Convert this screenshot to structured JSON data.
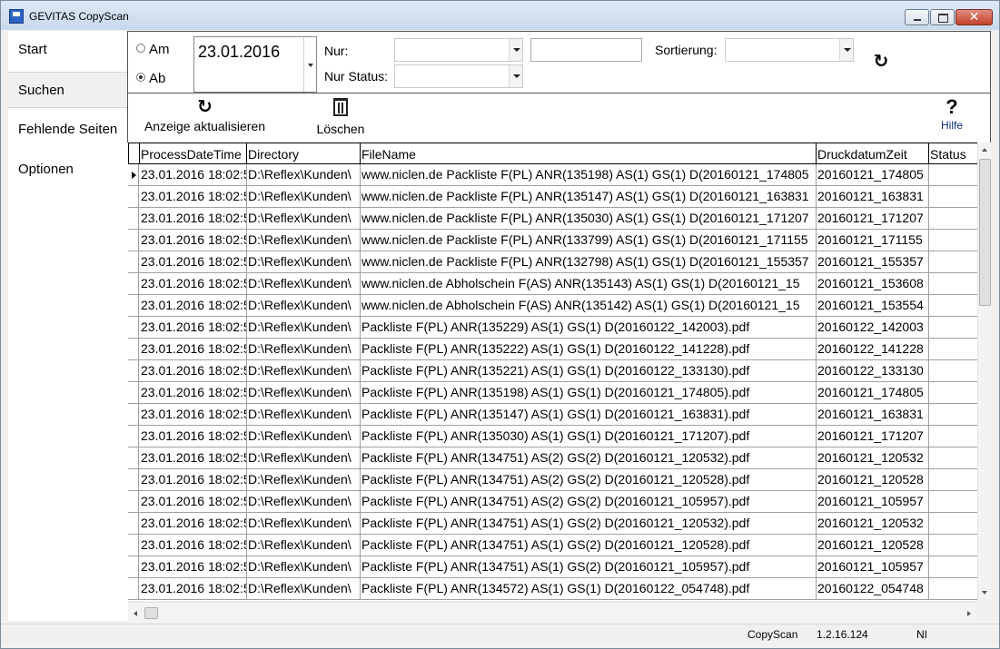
{
  "window": {
    "title": "GEVITAS CopyScan"
  },
  "nav": {
    "items": [
      {
        "label": "Start"
      },
      {
        "label": "Suchen"
      },
      {
        "label": "Fehlende Seiten"
      },
      {
        "label": "Optionen"
      }
    ],
    "active": "Suchen"
  },
  "filter": {
    "radio_am": "Am",
    "radio_ab": "Ab",
    "selected_radio": "Ab",
    "date_value": "23.01.2016",
    "nur_label": "Nur:",
    "nur_value": "",
    "nur_status_label": "Nur Status:",
    "nur_status_value": "",
    "text_value": "",
    "sortierung_label": "Sortierung:",
    "sortierung_value": ""
  },
  "toolbar": {
    "refresh_label": "Anzeige aktualisieren",
    "delete_label": "Löschen",
    "help_label": "Hilfe",
    "help_glyph": "?"
  },
  "table": {
    "columns": [
      "ProcessDateTime",
      "Directory",
      "FileName",
      "DruckdatumZeit",
      "Status"
    ],
    "rows": [
      [
        "23.01.2016 18:02:5",
        "D:\\Reflex\\Kunden\\",
        "www.niclen.de Packliste F(PL) ANR(135198) AS(1) GS(1) D(20160121_174805",
        "20160121_174805",
        ""
      ],
      [
        "23.01.2016 18:02:5",
        "D:\\Reflex\\Kunden\\",
        "www.niclen.de Packliste F(PL) ANR(135147) AS(1) GS(1) D(20160121_163831",
        "20160121_163831",
        ""
      ],
      [
        "23.01.2016 18:02:5",
        "D:\\Reflex\\Kunden\\",
        "www.niclen.de Packliste F(PL) ANR(135030) AS(1) GS(1) D(20160121_171207",
        "20160121_171207",
        ""
      ],
      [
        "23.01.2016 18:02:5",
        "D:\\Reflex\\Kunden\\",
        "www.niclen.de Packliste F(PL) ANR(133799) AS(1) GS(1) D(20160121_171155",
        "20160121_171155",
        ""
      ],
      [
        "23.01.2016 18:02:5",
        "D:\\Reflex\\Kunden\\",
        "www.niclen.de Packliste F(PL) ANR(132798) AS(1) GS(1) D(20160121_155357",
        "20160121_155357",
        ""
      ],
      [
        "23.01.2016 18:02:5",
        "D:\\Reflex\\Kunden\\",
        "www.niclen.de Abholschein F(AS) ANR(135143) AS(1) GS(1) D(20160121_15",
        "20160121_153608",
        ""
      ],
      [
        "23.01.2016 18:02:5",
        "D:\\Reflex\\Kunden\\",
        "www.niclen.de Abholschein F(AS) ANR(135142) AS(1) GS(1) D(20160121_15",
        "20160121_153554",
        ""
      ],
      [
        "23.01.2016 18:02:5",
        "D:\\Reflex\\Kunden\\",
        "Packliste F(PL) ANR(135229) AS(1) GS(1) D(20160122_142003).pdf",
        "20160122_142003",
        ""
      ],
      [
        "23.01.2016 18:02:5",
        "D:\\Reflex\\Kunden\\",
        "Packliste F(PL) ANR(135222) AS(1) GS(1) D(20160122_141228).pdf",
        "20160122_141228",
        ""
      ],
      [
        "23.01.2016 18:02:5",
        "D:\\Reflex\\Kunden\\",
        "Packliste F(PL) ANR(135221) AS(1) GS(1) D(20160122_133130).pdf",
        "20160122_133130",
        ""
      ],
      [
        "23.01.2016 18:02:5",
        "D:\\Reflex\\Kunden\\",
        "Packliste F(PL) ANR(135198) AS(1) GS(1) D(20160121_174805).pdf",
        "20160121_174805",
        ""
      ],
      [
        "23.01.2016 18:02:5",
        "D:\\Reflex\\Kunden\\",
        "Packliste F(PL) ANR(135147) AS(1) GS(1) D(20160121_163831).pdf",
        "20160121_163831",
        ""
      ],
      [
        "23.01.2016 18:02:5",
        "D:\\Reflex\\Kunden\\",
        "Packliste F(PL) ANR(135030) AS(1) GS(1) D(20160121_171207).pdf",
        "20160121_171207",
        ""
      ],
      [
        "23.01.2016 18:02:5",
        "D:\\Reflex\\Kunden\\",
        "Packliste F(PL) ANR(134751) AS(2) GS(2) D(20160121_120532).pdf",
        "20160121_120532",
        ""
      ],
      [
        "23.01.2016 18:02:5",
        "D:\\Reflex\\Kunden\\",
        "Packliste F(PL) ANR(134751) AS(2) GS(2) D(20160121_120528).pdf",
        "20160121_120528",
        ""
      ],
      [
        "23.01.2016 18:02:5",
        "D:\\Reflex\\Kunden\\",
        "Packliste F(PL) ANR(134751) AS(2) GS(2) D(20160121_105957).pdf",
        "20160121_105957",
        ""
      ],
      [
        "23.01.2016 18:02:5",
        "D:\\Reflex\\Kunden\\",
        "Packliste F(PL) ANR(134751) AS(1) GS(2) D(20160121_120532).pdf",
        "20160121_120532",
        ""
      ],
      [
        "23.01.2016 18:02:5",
        "D:\\Reflex\\Kunden\\",
        "Packliste F(PL) ANR(134751) AS(1) GS(2) D(20160121_120528).pdf",
        "20160121_120528",
        ""
      ],
      [
        "23.01.2016 18:02:5",
        "D:\\Reflex\\Kunden\\",
        "Packliste F(PL) ANR(134751) AS(1) GS(2) D(20160121_105957).pdf",
        "20160121_105957",
        ""
      ],
      [
        "23.01.2016 18:02:5",
        "D:\\Reflex\\Kunden\\",
        "Packliste F(PL) ANR(134572) AS(1) GS(1) D(20160122_054748).pdf",
        "20160122_054748",
        ""
      ]
    ],
    "selected_row": 0
  },
  "statusbar": {
    "app": "CopyScan",
    "version": "1.2.16.124",
    "flag": "NI"
  },
  "icons": {
    "app": "app-icon",
    "refresh": "refresh-icon",
    "delete": "trash-icon",
    "help": "help-icon"
  }
}
